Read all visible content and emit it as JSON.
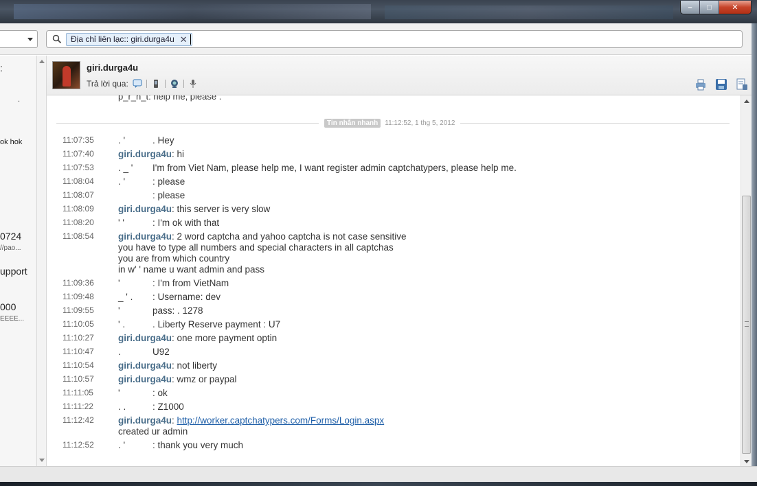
{
  "window": {
    "minimize_label": "–",
    "maximize_label": "□",
    "close_label": "✕"
  },
  "search": {
    "chip_label": "Địa chỉ liên lạc:: giri.durga4u",
    "chip_remove": "✕"
  },
  "sidebar": {
    "snippets": [
      ":",
      ".",
      "ok hok",
      "0724",
      "//pao...",
      "upport",
      "000",
      "EEEE..."
    ]
  },
  "contact": {
    "name": "giri.durga4u",
    "reply_label": "Trả lời qua:"
  },
  "chat": {
    "cutoff_line": "p_r_n_t: help me, please .",
    "divider": {
      "badge": "Tin nhắn nhanh",
      "timestamp": "11:12:52, 1 thg 5, 2012"
    },
    "messages": [
      {
        "time": "11:07:35",
        "sender": ". '",
        "text": ". Hey"
      },
      {
        "time": "11:07:40",
        "sender": "giri.durga4u",
        "text": ": hi"
      },
      {
        "time": "11:07:53",
        "sender": ". _ '",
        "text": "I'm from Viet Nam, please help me, I want register admin captchatypers, please help me."
      },
      {
        "time": "11:08:04",
        "sender": ". '",
        "text": ": please"
      },
      {
        "time": "11:08:07",
        "sender": "",
        "text": ": please"
      },
      {
        "time": "11:08:09",
        "sender": "giri.durga4u",
        "text": ": this server is very slow"
      },
      {
        "time": "11:08:20",
        "sender": "' '",
        "text": ": I'm ok with that"
      },
      {
        "time": "11:08:54",
        "sender": "giri.durga4u",
        "text": ": 2 word captcha and yahoo captcha is not case sensitive",
        "extra": [
          "you have to type all numbers and special characters in all captchas",
          "you are from which country",
          "in w' ' name u want admin and pass"
        ]
      },
      {
        "time": "11:09:36",
        "sender": "'",
        "text": ": I'm from VietNam"
      },
      {
        "time": "11:09:48",
        "sender": "_ ' .",
        "text": ": Username: dev"
      },
      {
        "time": "11:09:55",
        "sender": "'",
        "text": "pass: . 1278"
      },
      {
        "time": "11:10:05",
        "sender": "' .",
        "text": ". Liberty Reserve payment : U7"
      },
      {
        "time": "11:10:27",
        "sender": "giri.durga4u",
        "text": ": one more payment optin"
      },
      {
        "time": "11:10:47",
        "sender": ".",
        "text": "U92"
      },
      {
        "time": "11:10:54",
        "sender": "giri.durga4u",
        "text": ": not liberty"
      },
      {
        "time": "11:10:57",
        "sender": "giri.durga4u",
        "text": ": wmz or paypal"
      },
      {
        "time": "11:11:05",
        "sender": "'",
        "text": ": ok"
      },
      {
        "time": "11:11:22",
        "sender": ". .",
        "text": ": Z1000"
      },
      {
        "time": "11:12:42",
        "sender": "giri.durga4u",
        "link": "http://worker.captchatypers.com/Forms/Login.aspx",
        "extra": [
          "created ur admin"
        ]
      },
      {
        "time": "11:12:52",
        "sender": ". '",
        "text": ": thank you very much"
      }
    ]
  }
}
